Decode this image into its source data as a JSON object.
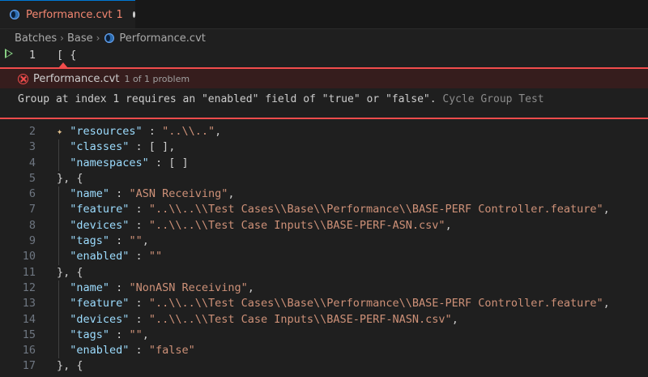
{
  "tab": {
    "title": "Performance.cvt",
    "problem_count": "1",
    "file_icon": "cvt-file-icon"
  },
  "breadcrumb": {
    "items": [
      "Batches",
      "Base",
      "Performance.cvt"
    ]
  },
  "editor_first_line": {
    "number": "1",
    "text": "[ {"
  },
  "problem_peek": {
    "file": "Performance.cvt",
    "count_text": "1 of 1 problem",
    "message": "Group at index 1 requires an \"enabled\" field of \"true\" or \"false\".",
    "source": "Cycle Group Test"
  },
  "code_lines": [
    {
      "n": "2",
      "parts": [
        [
          "p",
          "  "
        ],
        [
          "k",
          "\"resources\""
        ],
        [
          "p",
          " : "
        ],
        [
          "s",
          "\"..\\\\..\""
        ],
        [
          "p",
          ","
        ]
      ]
    },
    {
      "n": "3",
      "parts": [
        [
          "p",
          "  "
        ],
        [
          "k",
          "\"classes\""
        ],
        [
          "p",
          " : [ ],"
        ]
      ]
    },
    {
      "n": "4",
      "parts": [
        [
          "p",
          "  "
        ],
        [
          "k",
          "\"namespaces\""
        ],
        [
          "p",
          " : [ ]"
        ]
      ]
    },
    {
      "n": "5",
      "parts": [
        [
          "p",
          "}, {"
        ]
      ]
    },
    {
      "n": "6",
      "parts": [
        [
          "p",
          "  "
        ],
        [
          "k",
          "\"name\""
        ],
        [
          "p",
          " : "
        ],
        [
          "s",
          "\"ASN Receiving\""
        ],
        [
          "p",
          ","
        ]
      ]
    },
    {
      "n": "7",
      "parts": [
        [
          "p",
          "  "
        ],
        [
          "k",
          "\"feature\""
        ],
        [
          "p",
          " : "
        ],
        [
          "s",
          "\"..\\\\..\\\\Test Cases\\\\Base\\\\Performance\\\\BASE-PERF Controller.feature\""
        ],
        [
          "p",
          ","
        ]
      ]
    },
    {
      "n": "8",
      "parts": [
        [
          "p",
          "  "
        ],
        [
          "k",
          "\"devices\""
        ],
        [
          "p",
          " : "
        ],
        [
          "s",
          "\"..\\\\..\\\\Test Case Inputs\\\\BASE-PERF-ASN.csv\""
        ],
        [
          "p",
          ","
        ]
      ]
    },
    {
      "n": "9",
      "parts": [
        [
          "p",
          "  "
        ],
        [
          "k",
          "\"tags\""
        ],
        [
          "p",
          " : "
        ],
        [
          "s",
          "\"\""
        ],
        [
          "p",
          ","
        ]
      ]
    },
    {
      "n": "10",
      "parts": [
        [
          "p",
          "  "
        ],
        [
          "k",
          "\"enabled\""
        ],
        [
          "p",
          " : "
        ],
        [
          "s",
          "\"\""
        ]
      ]
    },
    {
      "n": "11",
      "parts": [
        [
          "p",
          "}, {"
        ]
      ]
    },
    {
      "n": "12",
      "parts": [
        [
          "p",
          "  "
        ],
        [
          "k",
          "\"name\""
        ],
        [
          "p",
          " : "
        ],
        [
          "s",
          "\"NonASN Receiving\""
        ],
        [
          "p",
          ","
        ]
      ]
    },
    {
      "n": "13",
      "parts": [
        [
          "p",
          "  "
        ],
        [
          "k",
          "\"feature\""
        ],
        [
          "p",
          " : "
        ],
        [
          "s",
          "\"..\\\\..\\\\Test Cases\\\\Base\\\\Performance\\\\BASE-PERF Controller.feature\""
        ],
        [
          "p",
          ","
        ]
      ]
    },
    {
      "n": "14",
      "parts": [
        [
          "p",
          "  "
        ],
        [
          "k",
          "\"devices\""
        ],
        [
          "p",
          " : "
        ],
        [
          "s",
          "\"..\\\\..\\\\Test Case Inputs\\\\BASE-PERF-NASN.csv\""
        ],
        [
          "p",
          ","
        ]
      ]
    },
    {
      "n": "15",
      "parts": [
        [
          "p",
          "  "
        ],
        [
          "k",
          "\"tags\""
        ],
        [
          "p",
          " : "
        ],
        [
          "s",
          "\"\""
        ],
        [
          "p",
          ","
        ]
      ]
    },
    {
      "n": "16",
      "parts": [
        [
          "p",
          "  "
        ],
        [
          "k",
          "\"enabled\""
        ],
        [
          "p",
          " : "
        ],
        [
          "s",
          "\"false\""
        ]
      ]
    },
    {
      "n": "17",
      "parts": [
        [
          "p",
          "}, {"
        ]
      ]
    }
  ],
  "colors": {
    "key": "#9cdcfe",
    "string": "#ce9178",
    "error": "#f14c4c",
    "accent": "#0078d4"
  },
  "icons": {
    "run": "run-icon",
    "error": "error-circle-icon",
    "sparkle": "sparkle-icon"
  }
}
